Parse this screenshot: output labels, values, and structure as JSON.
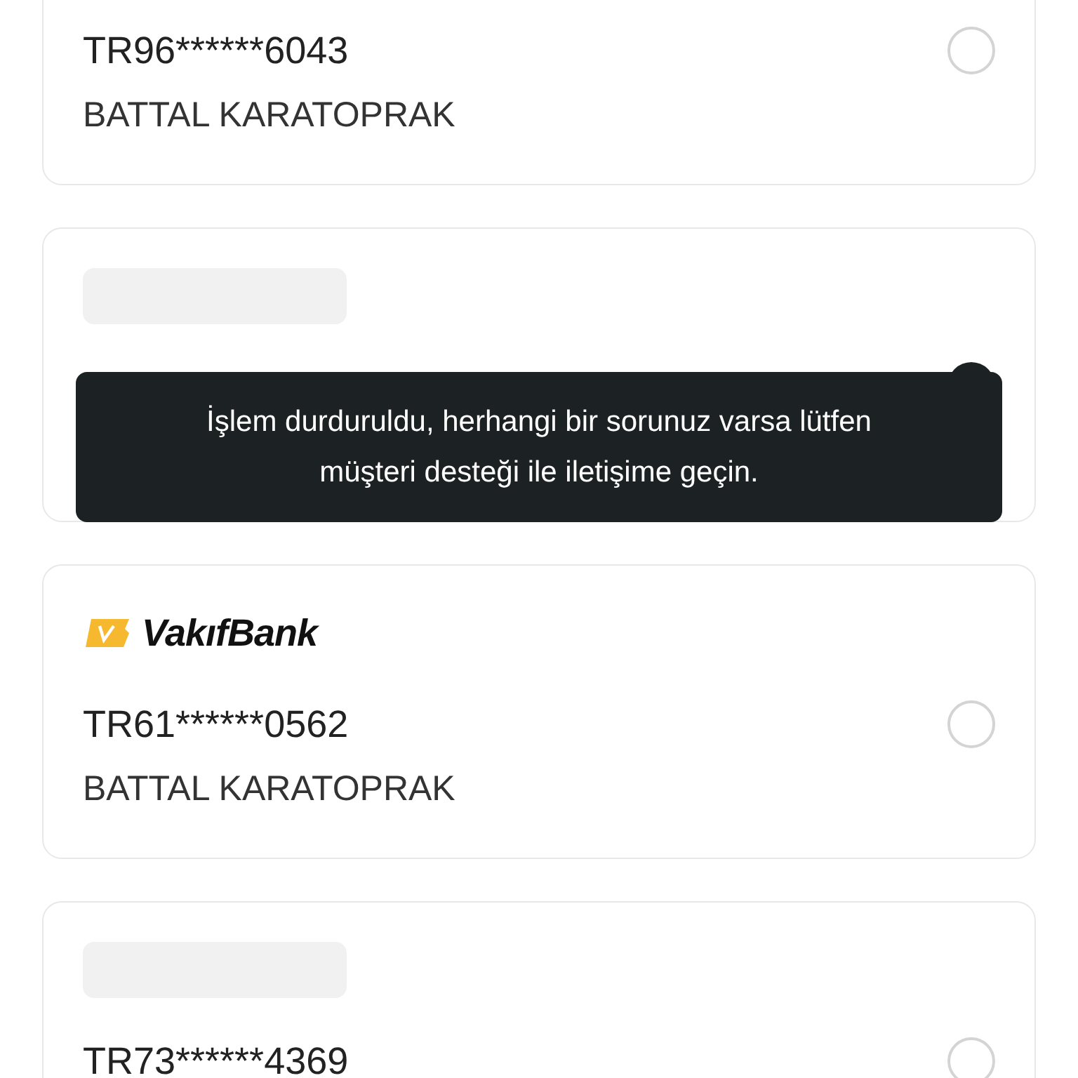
{
  "accounts": [
    {
      "iban": "TR96******6043",
      "holder": "BATTAL KARATOPRAK",
      "selected": false
    },
    {
      "kind": "skeleton",
      "selected": true
    },
    {
      "kind": "logo",
      "bank": "VakıfBank",
      "iban": "TR61******0562",
      "holder": "BATTAL KARATOPRAK",
      "selected": false
    },
    {
      "kind": "skeleton",
      "iban": "TR73******4369",
      "selected": false
    }
  ],
  "toast": {
    "message": "İşlem durduruldu, herhangi bir sorunuz varsa lütfen müşteri desteği ile iletişime geçin."
  }
}
